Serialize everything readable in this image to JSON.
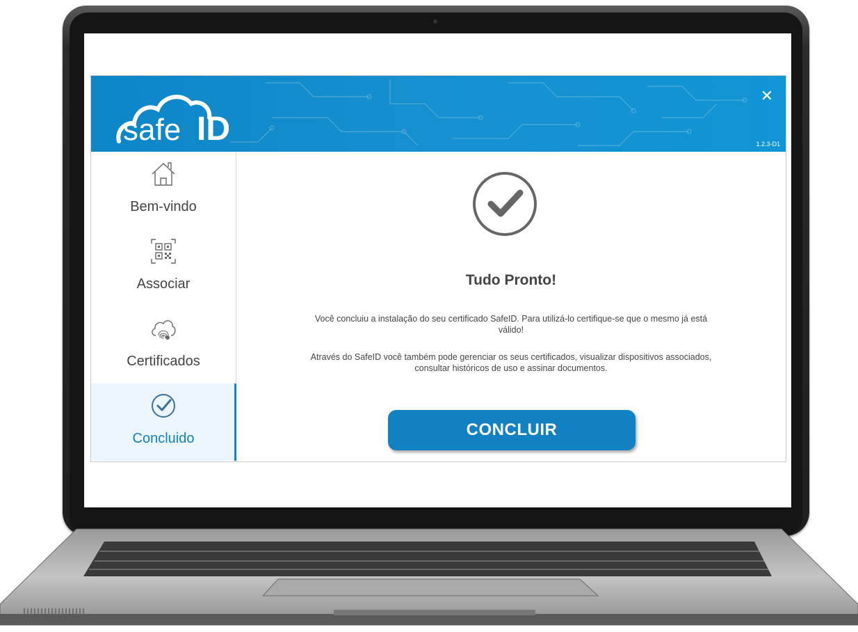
{
  "app": {
    "logo_text": "safeID",
    "version": "1.2.3-D1",
    "close_label": "✕"
  },
  "sidebar": {
    "items": [
      {
        "label": "Bem-vindo",
        "icon": "home-icon"
      },
      {
        "label": "Associar",
        "icon": "qr-code-icon"
      },
      {
        "label": "Certificados",
        "icon": "cloud-fingerprint-icon"
      },
      {
        "label": "Concluido",
        "icon": "check-circle-icon",
        "active": true
      }
    ]
  },
  "main": {
    "title": "Tudo Pronto!",
    "paragraph1": "Você concluiu a instalação do seu certificado SafeID. Para utilizá-lo certifique-se que o mesmo já está válido!",
    "paragraph2": "Através do SafeID você também pode gerenciar os seus certificados, visualizar dispositivos associados, consultar históricos de uso e assinar documentos.",
    "button_label": "CONCLUIR"
  },
  "colors": {
    "brand_blue": "#1181c1",
    "header_blue": "#168fcf"
  }
}
